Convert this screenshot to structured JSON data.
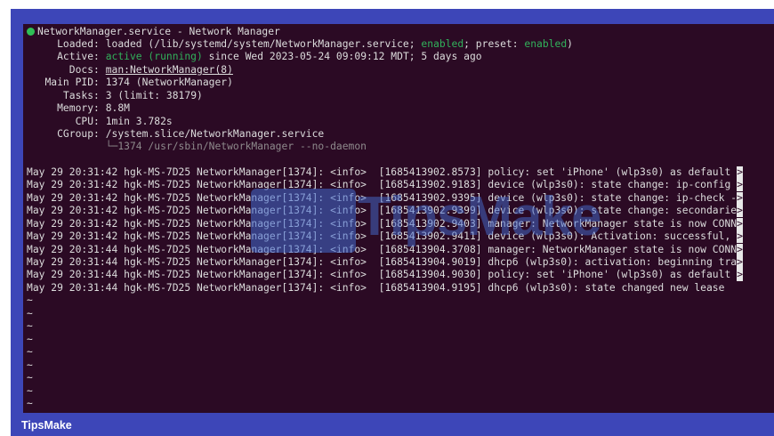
{
  "status": {
    "header": "NetworkManager.service - Network Manager",
    "loaded_label": "Loaded:",
    "loaded_prefix": "loaded (/lib/systemd/system/NetworkManager.service;",
    "loaded_enabled": "enabled",
    "loaded_preset_label": "; preset:",
    "loaded_preset_value": "enabled",
    "loaded_suffix": ")",
    "active_label": "Active:",
    "active_state": "active (running)",
    "active_since": "since Wed 2023-05-24 09:09:12 MDT; 5 days ago",
    "docs_label": "Docs:",
    "docs_value": "man:NetworkManager(8)",
    "pid_label": "Main PID:",
    "pid_value": "1374 (NetworkManager)",
    "tasks_label": "Tasks:",
    "tasks_value": "3 (limit: 38179)",
    "memory_label": "Memory:",
    "memory_value": "8.8M",
    "cpu_label": "CPU:",
    "cpu_value": "1min 3.782s",
    "cgroup_label": "CGroup:",
    "cgroup_value": "/system.slice/NetworkManager.service",
    "cgroup_child": "└─1374 /usr/sbin/NetworkManager --no-daemon"
  },
  "logs": [
    "May 29 20:31:42 hgk-MS-7D25 NetworkManager[1374]: <info>  [1685413902.8573] policy: set 'iPhone' (wlp3s0) as default",
    "May 29 20:31:42 hgk-MS-7D25 NetworkManager[1374]: <info>  [1685413902.9183] device (wlp3s0): state change: ip-config",
    "May 29 20:31:42 hgk-MS-7D25 NetworkManager[1374]: <info>  [1685413902.9395] device (wlp3s0): state change: ip-check -",
    "May 29 20:31:42 hgk-MS-7D25 NetworkManager[1374]: <info>  [1685413902.9399] device (wlp3s0): state change: secondarie",
    "May 29 20:31:42 hgk-MS-7D25 NetworkManager[1374]: <info>  [1685413902.9403] manager: NetworkManager state is now CONN",
    "May 29 20:31:42 hgk-MS-7D25 NetworkManager[1374]: <info>  [1685413902.9411] device (wlp3s0): Activation: successful,",
    "May 29 20:31:44 hgk-MS-7D25 NetworkManager[1374]: <info>  [1685413904.3708] manager: NetworkManager state is now CONN",
    "May 29 20:31:44 hgk-MS-7D25 NetworkManager[1374]: <info>  [1685413904.9019] dhcp6 (wlp3s0): activation: beginning tra",
    "May 29 20:31:44 hgk-MS-7D25 NetworkManager[1374]: <info>  [1685413904.9030] policy: set 'iPhone' (wlp3s0) as default",
    "May 29 20:31:44 hgk-MS-7D25 NetworkManager[1374]: <info>  [1685413904.9195] dhcp6 (wlp3s0): state changed new lease"
  ],
  "more_marker": ">",
  "tilde": "~",
  "watermark": {
    "text": "TipsMake"
  },
  "footer": {
    "label": "TipsMake"
  },
  "colors": {
    "terminal_bg": "#2b0a24",
    "frame": "#3d46b8",
    "green": "#31b25b"
  }
}
